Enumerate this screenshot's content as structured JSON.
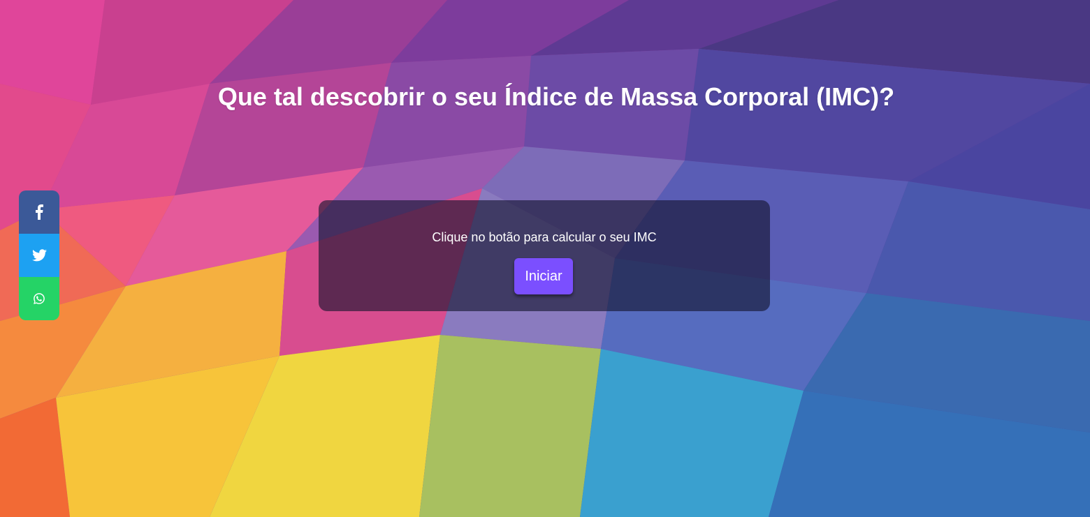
{
  "header": {
    "title": "Que tal descobrir o seu Índice de Massa Corporal (IMC)?"
  },
  "card": {
    "prompt": "Clique no botão para calcular o seu IMC",
    "start_label": "Iniciar"
  },
  "social": {
    "items": [
      {
        "name": "facebook",
        "icon": "facebook-icon",
        "color": "#3b5998"
      },
      {
        "name": "twitter",
        "icon": "twitter-icon",
        "color": "#1da1f2"
      },
      {
        "name": "whatsapp",
        "icon": "whatsapp-icon",
        "color": "#25d366"
      }
    ]
  },
  "colors": {
    "button": "#7b4fff",
    "card_bg": "rgba(20,20,45,0.62)",
    "text": "#ffffff"
  }
}
